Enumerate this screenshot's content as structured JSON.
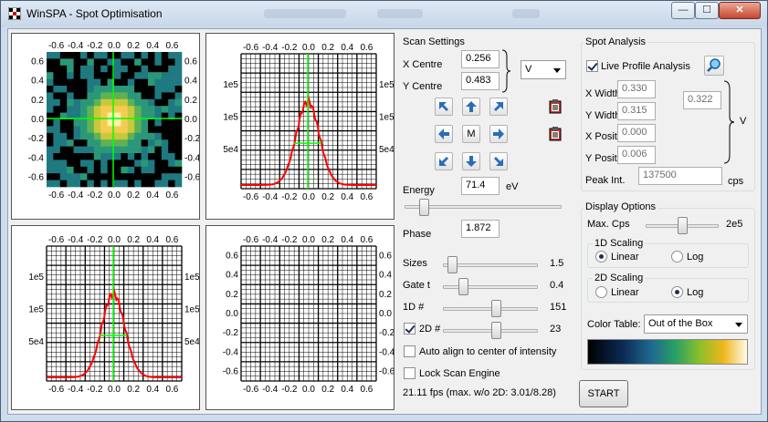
{
  "window": {
    "title": "WinSPA - Spot Optimisation",
    "controls": {
      "minimize": "—",
      "maximize": "☐",
      "close": "✕"
    }
  },
  "plots": {
    "axis_ticks": [
      "-0.6",
      "-0.4",
      "-0.2",
      "0.0",
      "0.2",
      "0.4",
      "0.6"
    ],
    "tl_y_ticks": [
      "0.6",
      "0.4",
      "0.2",
      "0.0",
      "-0.2",
      "-0.4",
      "-0.6"
    ],
    "tr_y_ticks": [
      "1e5",
      "1e5",
      "5e4"
    ],
    "bl_y_ticks": [
      "1e5",
      "1e5",
      "5e4"
    ],
    "br_y_ticks": [
      "0.6",
      "0.4",
      "0.2",
      "0.0",
      "-0.2",
      "-0.4",
      "-0.6"
    ],
    "colors": {
      "profile": "#ff0000",
      "crosshair": "#00ff00",
      "grid": "#000000"
    }
  },
  "scan": {
    "group_title": "Scan Settings",
    "x_centre_label": "X Centre",
    "x_centre": "0.256",
    "y_centre_label": "Y Centre",
    "y_centre": "0.483",
    "unit_select": "V",
    "move_center_label": "M",
    "energy_label": "Energy",
    "energy": "71.4",
    "energy_unit": "eV",
    "phase_label": "Phase",
    "phase": "1.872",
    "sizes_label": "Sizes",
    "sizes": "1.5",
    "gate_label": "Gate t",
    "gate": "0.4",
    "oned_label": "1D #",
    "oned": "151",
    "twod_label": "2D #",
    "twod": "23",
    "auto_align_label": "Auto align to center of intensity",
    "lock_label": "Lock Scan Engine",
    "fps_text": "21.11 fps (max. w/o 2D: 3.01/8.28)",
    "sliders": {
      "energy": 0.1,
      "sizes": 0.05,
      "gate": 0.18,
      "oned": 0.57,
      "twod": 0.57
    },
    "twod_checked": true,
    "auto_align_checked": false,
    "lock_checked": false
  },
  "spot": {
    "group_title": "Spot Analysis",
    "live_label": "Live Profile Analysis",
    "live_checked": true,
    "x_width_label": "X Width",
    "x_width": "0.330",
    "y_width_label": "Y Width",
    "y_width": "0.315",
    "avg_width": "0.322",
    "x_pos_label": "X Position",
    "x_pos": "0.000",
    "y_pos_label": "Y Position",
    "y_pos": "0.006",
    "unit": "V",
    "peak_label": "Peak Int.",
    "peak": "137500",
    "peak_unit": "cps"
  },
  "display": {
    "group_title": "Display Options",
    "max_cps_label": "Max. Cps",
    "max_cps": "2e5",
    "max_cps_slider": 0.5,
    "scaling1d_title": "1D Scaling",
    "scaling2d_title": "2D Scaling",
    "linear_label": "Linear",
    "log_label": "Log",
    "scaling1d": "Linear",
    "scaling2d": "Log",
    "color_table_label": "Color Table:",
    "color_table": "Out of the Box"
  },
  "start_label": "START"
}
